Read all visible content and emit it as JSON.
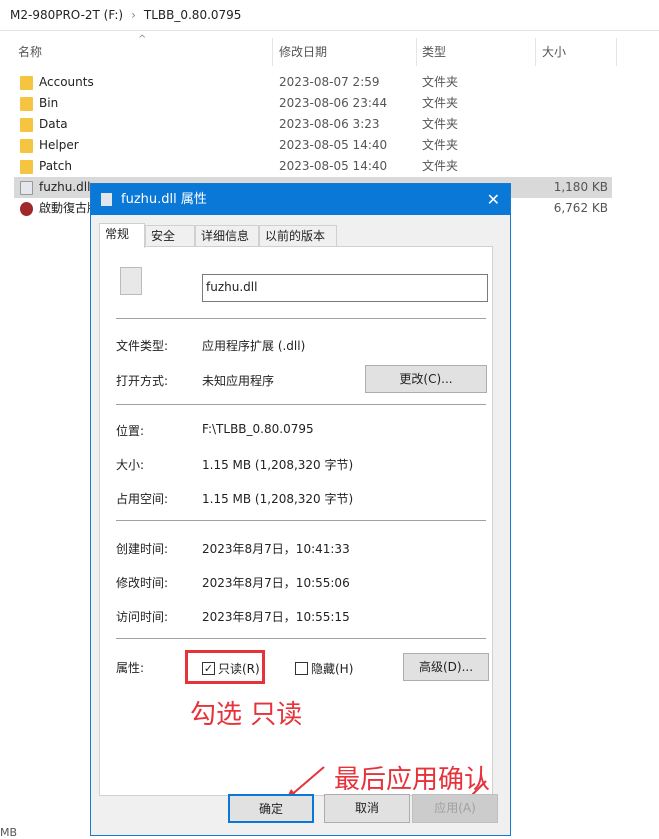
{
  "breadcrumb": [
    "M2-980PRO-2T (F:)",
    "TLBB_0.80.0795"
  ],
  "columns": {
    "name": "名称",
    "date": "修改日期",
    "type": "类型",
    "size": "大小"
  },
  "files": [
    {
      "name": "Accounts",
      "date": "2023-08-07 2:59",
      "type": "文件夹",
      "size": "",
      "icon": "folder-icon"
    },
    {
      "name": "Bin",
      "date": "2023-08-06 23:44",
      "type": "文件夹",
      "size": "",
      "icon": "folder-icon"
    },
    {
      "name": "Data",
      "date": "2023-08-06 3:23",
      "type": "文件夹",
      "size": "",
      "icon": "folder-icon"
    },
    {
      "name": "Helper",
      "date": "2023-08-05 14:40",
      "type": "文件夹",
      "size": "",
      "icon": "folder-icon"
    },
    {
      "name": "Patch",
      "date": "2023-08-05 14:40",
      "type": "文件夹",
      "size": "",
      "icon": "folder-icon"
    },
    {
      "name": "fuzhu.dll",
      "date": "",
      "type": "",
      "size": "1,180 KB",
      "icon": "dll-file-icon"
    },
    {
      "name": "啟動復古版",
      "date": "",
      "type": "",
      "size": "6,762 KB",
      "icon": "app-icon"
    }
  ],
  "status_fragment": "MB",
  "dialog": {
    "title": "fuzhu.dll 属性",
    "tabs": [
      "常规",
      "安全",
      "详细信息",
      "以前的版本"
    ],
    "filename": "fuzhu.dll",
    "props": {
      "type_label": "文件类型:",
      "type_value": "应用程序扩展 (.dll)",
      "open_label": "打开方式:",
      "open_value": "未知应用程序",
      "change_button": "更改(C)...",
      "location_label": "位置:",
      "location_value": "F:\\TLBB_0.80.0795",
      "size_label": "大小:",
      "size_value": "1.15 MB (1,208,320 字节)",
      "disk_label": "占用空间:",
      "disk_value": "1.15 MB (1,208,320 字节)",
      "created_label": "创建时间:",
      "created_value": "2023年8月7日，10:41:33",
      "modified_label": "修改时间:",
      "modified_value": "2023年8月7日，10:55:06",
      "accessed_label": "访问时间:",
      "accessed_value": "2023年8月7日，10:55:15",
      "attr_label": "属性:",
      "readonly_label": "只读(R)",
      "readonly_checked": true,
      "hidden_label": "隐藏(H)",
      "hidden_checked": false,
      "advanced_button": "高级(D)..."
    },
    "ok": "确定",
    "cancel": "取消",
    "apply": "应用(A)"
  },
  "annotations": {
    "check_readonly": "勾选 只读",
    "apply_confirm": "最后应用确认",
    "color": "#e8323a"
  }
}
